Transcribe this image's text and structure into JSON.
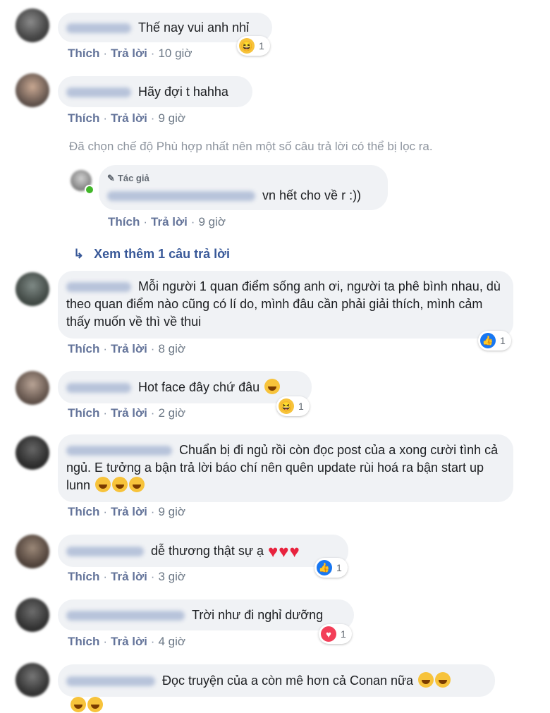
{
  "comments": [
    {
      "text": "Thế nay vui anh nhỉ",
      "like": "Thích",
      "reply": "Trả lời",
      "time": "10 giờ",
      "reaction_count": "1",
      "reaction": "haha"
    },
    {
      "text": "Hãy đợi t hahha",
      "like": "Thích",
      "reply": "Trả lời",
      "time": "9 giờ"
    },
    {
      "text": "Mỗi người 1 quan điểm sống anh ơi, người ta phê bình nhau, dù theo quan điểm nào cũng có lí do, mình đâu cần phải giải thích, mình cảm thấy muốn về thì về thui",
      "like": "Thích",
      "reply": "Trả lời",
      "time": "8 giờ",
      "reaction_count": "1",
      "reaction": "like"
    },
    {
      "text": "Hot face đây chứ đâu",
      "like": "Thích",
      "reply": "Trả lời",
      "time": "2 giờ",
      "reaction_count": "1",
      "reaction": "haha"
    },
    {
      "text": "Chuẩn bị đi ngủ rồi còn đọc post của a xong cười tình cả ngủ. E tưởng a bận trả lời báo chí nên quên update rùi hoá ra bận start up lunn",
      "like": "Thích",
      "reply": "Trả lời",
      "time": "9 giờ"
    },
    {
      "text": "dễ thương thật sự ạ",
      "like": "Thích",
      "reply": "Trả lời",
      "time": "3 giờ",
      "reaction_count": "1",
      "reaction": "like"
    },
    {
      "text": "Trời như đi nghỉ dưỡng",
      "like": "Thích",
      "reply": "Trả lời",
      "time": "4 giờ",
      "reaction_count": "1",
      "reaction": "love"
    },
    {
      "text": "Đọc truyện của a còn mê hơn cả Conan nữa"
    }
  ],
  "filter_notice": "Đã chọn chế độ Phù hợp nhất nên một số câu trả lời có thể bị lọc ra.",
  "author_reply": {
    "badge": "Tác giả",
    "text": "vn hết cho về r :))",
    "like": "Thích",
    "reply": "Trả lời",
    "time": "9 giờ"
  },
  "view_more": "Xem thêm 1 câu trả lời",
  "colors": {
    "bubble": "#f0f2f5",
    "link": "#385898",
    "like": "#1877f2",
    "love": "#f33e58",
    "haha": "#f7c33b"
  }
}
